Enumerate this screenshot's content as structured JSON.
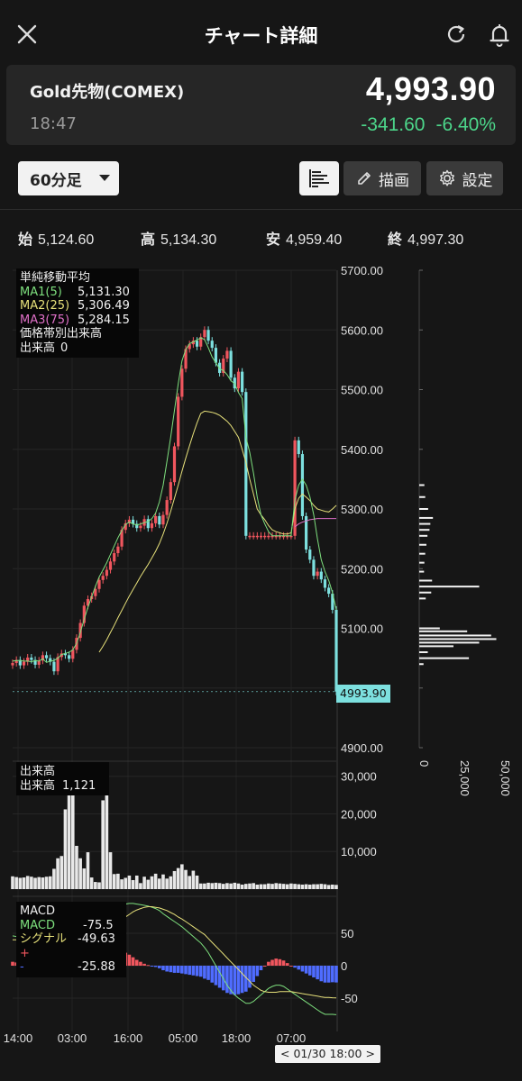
{
  "header": {
    "title": "チャート詳細"
  },
  "quote": {
    "instrument": "Gold先物(COMEX)",
    "time": "18:47",
    "price": "4,993.90",
    "change": "-341.60",
    "change_pct": "-6.40%",
    "down_color": "#4cd68a"
  },
  "controls": {
    "interval": "60分足",
    "draw_label": "描画",
    "settings_label": "設定"
  },
  "ohlc": {
    "open_label": "始",
    "open": "5,124.60",
    "high_label": "高",
    "high": "5,134.30",
    "low_label": "安",
    "low": "4,959.40",
    "close_label": "終",
    "close": "4,997.30"
  },
  "legend_main": {
    "title": "単純移動平均",
    "ma1_label": "MA1(5)",
    "ma1_value": "5,131.30",
    "ma2_label": "MA2(25)",
    "ma2_value": "5,306.49",
    "ma3_label": "MA3(75)",
    "ma3_value": "5,284.15",
    "profile_title": "価格帯別出来高",
    "profile_label": "出来高",
    "profile_value": "0",
    "ma1_color": "#7ee07e",
    "ma2_color": "#e6e07a",
    "ma3_color": "#e070c8"
  },
  "legend_volume": {
    "title": "出来高",
    "label": "出来高",
    "value": "1,121"
  },
  "legend_macd": {
    "title": "MACD",
    "macd_label": "MACD",
    "macd_value": "-75.5",
    "signal_label": "シグナル",
    "signal_value": "-49.63",
    "plus_label": "+",
    "minus_label": "-",
    "hist_value": "-25.88"
  },
  "badges": {
    "last_price": "4993.90",
    "cursor_time": "< 01/30 18:00 >"
  },
  "chart_data": {
    "type": "candlestick",
    "price_axis": {
      "ticks": [
        "5700.00",
        "5600.00",
        "5500.00",
        "5400.00",
        "5300.00",
        "5200.00",
        "5100.00",
        "4900.00"
      ],
      "ylim": [
        4900,
        5700
      ]
    },
    "volume_axis": {
      "ticks": [
        "30,000",
        "20,000",
        "10,000"
      ]
    },
    "macd_axis": {
      "ticks": [
        "50",
        "0",
        "-50"
      ]
    },
    "profile_axis": {
      "ticks": [
        "0",
        "25,000",
        "50,000"
      ]
    },
    "time_axis": {
      "ticks": [
        "14:00",
        "03:00",
        "16:00",
        "05:00",
        "18:00",
        "07:00"
      ]
    },
    "close": [
      5042,
      5047,
      5038,
      5044,
      5051,
      5047,
      5039,
      5046,
      5055,
      5050,
      5044,
      5028,
      5052,
      5058,
      5055,
      5049,
      5064,
      5084,
      5109,
      5138,
      5149,
      5154,
      5166,
      5181,
      5188,
      5198,
      5212,
      5226,
      5237,
      5265,
      5276,
      5282,
      5275,
      5268,
      5272,
      5283,
      5268,
      5276,
      5288,
      5274,
      5290,
      5315,
      5345,
      5405,
      5488,
      5535,
      5568,
      5576,
      5582,
      5572,
      5588,
      5600,
      5582,
      5570,
      5545,
      5528,
      5552,
      5565,
      5520,
      5502,
      5530,
      5496,
      5255,
      5255,
      5255,
      5255,
      5255,
      5255,
      5255,
      5255,
      5255,
      5255,
      5255,
      5255,
      5255,
      5415,
      5392,
      5288,
      5232,
      5215,
      5188,
      5195,
      5182,
      5168,
      5158,
      5131,
      4994
    ],
    "ma1": [
      5045,
      5046,
      5046,
      5045,
      5045,
      5044,
      5046,
      5045,
      5049,
      5043,
      5045,
      5046,
      5050,
      5056,
      5058,
      5060,
      5064,
      5075,
      5093,
      5115,
      5135,
      5153,
      5170,
      5186,
      5198,
      5210,
      5224,
      5238,
      5252,
      5264,
      5274,
      5278,
      5275,
      5273,
      5275,
      5277,
      5279,
      5284,
      5293,
      5312,
      5340,
      5380,
      5420,
      5465,
      5510,
      5548,
      5567,
      5577,
      5580,
      5583,
      5587,
      5584,
      5570,
      5555,
      5545,
      5535,
      5532,
      5525,
      5515,
      5510,
      5495,
      5485,
      5420,
      5395,
      5360,
      5320,
      5290,
      5275,
      5262,
      5255,
      5255,
      5255,
      5255,
      5255,
      5255,
      5315,
      5340,
      5350,
      5340,
      5320,
      5290,
      5250,
      5215,
      5195,
      5180,
      5160,
      5131
    ],
    "ma2": [
      null,
      null,
      null,
      null,
      null,
      null,
      null,
      null,
      null,
      null,
      null,
      null,
      null,
      null,
      null,
      null,
      null,
      null,
      null,
      null,
      null,
      null,
      null,
      5060,
      5070,
      5081,
      5093,
      5105,
      5118,
      5130,
      5142,
      5154,
      5165,
      5176,
      5187,
      5197,
      5207,
      5218,
      5229,
      5242,
      5258,
      5276,
      5296,
      5318,
      5340,
      5363,
      5385,
      5406,
      5426,
      5444,
      5460,
      5464,
      5463,
      5462,
      5460,
      5457,
      5452,
      5447,
      5440,
      5430,
      5420,
      5400,
      5378,
      5350,
      5325,
      5300,
      5290,
      5282,
      5272,
      5265,
      5262,
      5260,
      5258,
      5258,
      5260,
      5300,
      5318,
      5325,
      5320,
      5314,
      5306,
      5300,
      5298,
      5296,
      5295,
      5300,
      5306
    ],
    "ma3": [
      null,
      null,
      null,
      null,
      null,
      null,
      null,
      null,
      null,
      null,
      null,
      null,
      null,
      null,
      null,
      null,
      null,
      null,
      null,
      null,
      null,
      null,
      null,
      null,
      null,
      null,
      null,
      null,
      null,
      null,
      null,
      null,
      null,
      null,
      null,
      null,
      null,
      null,
      null,
      null,
      null,
      null,
      null,
      null,
      null,
      null,
      null,
      null,
      null,
      null,
      null,
      null,
      null,
      null,
      null,
      null,
      null,
      null,
      null,
      null,
      null,
      null,
      null,
      null,
      null,
      null,
      null,
      null,
      null,
      null,
      null,
      null,
      null,
      null,
      null,
      5270,
      5275,
      5278,
      5280,
      5282,
      5283,
      5284,
      5284,
      5284,
      5284,
      5284,
      5284
    ],
    "volume": [
      3400,
      3200,
      3000,
      3100,
      3500,
      3300,
      3000,
      3200,
      3100,
      3300,
      3400,
      5400,
      8200,
      8800,
      21200,
      28500,
      26800,
      11500,
      8200,
      5500,
      9800,
      3100,
      1900,
      1800,
      23600,
      28300,
      9800,
      4000,
      4100,
      2600,
      3000,
      3600,
      2400,
      3600,
      1600,
      3300,
      2500,
      3400,
      4100,
      2800,
      3900,
      2800,
      3400,
      4800,
      5600,
      6600,
      5100,
      3500,
      4900,
      3600,
      1500,
      1500,
      1700,
      1600,
      1700,
      1600,
      1400,
      1600,
      1500,
      1700,
      1500,
      1200,
      1400,
      1500,
      1600,
      1200,
      1300,
      1300,
      1500,
      1400,
      1600,
      1500,
      1400,
      1300,
      1500,
      1400,
      1300,
      1200,
      1300,
      1200,
      1300,
      1300,
      1400,
      1300,
      1100,
      1200,
      1121
    ],
    "macd": [
      46,
      45,
      44,
      43,
      42,
      42,
      40,
      38,
      36,
      34,
      33,
      32,
      30,
      31,
      32,
      33,
      34,
      36,
      39,
      43,
      46,
      50,
      54,
      58,
      62,
      68,
      76,
      82,
      88,
      92,
      95,
      96,
      96,
      95,
      94,
      93,
      92,
      90,
      88,
      85,
      80,
      76,
      72,
      68,
      64,
      60,
      55,
      50,
      45,
      40,
      35,
      28,
      20,
      10,
      0,
      -10,
      -20,
      -30,
      -38,
      -45,
      -50,
      -54,
      -58,
      -58,
      -55,
      -50,
      -45,
      -40,
      -35,
      -32,
      -30,
      -30,
      -32,
      -36,
      -40,
      -44,
      -48,
      -52,
      -56,
      -60,
      -64,
      -68,
      -72,
      -75,
      -75,
      -75,
      -75.5
    ],
    "signal": [
      40,
      40,
      40,
      39,
      39,
      38,
      38,
      37,
      36,
      35,
      34,
      33,
      32,
      32,
      32,
      32,
      33,
      33,
      34,
      35,
      37,
      39,
      41,
      44,
      47,
      51,
      55,
      60,
      65,
      70,
      75,
      79,
      83,
      86,
      88,
      90,
      91,
      91,
      90,
      89,
      87,
      85,
      82,
      79,
      75,
      72,
      68,
      64,
      60,
      56,
      52,
      48,
      42,
      36,
      30,
      24,
      18,
      12,
      6,
      0,
      -6,
      -12,
      -18,
      -24,
      -30,
      -34,
      -38,
      -40,
      -41,
      -41,
      -41,
      -40,
      -40,
      -40,
      -40,
      -41,
      -42,
      -43,
      -44,
      -45,
      -46,
      -47,
      -48,
      -49,
      -49,
      -49.5,
      -49.63
    ],
    "profile_volume": [
      {
        "price": 5340,
        "vol": 3000
      },
      {
        "price": 5320,
        "vol": 3500
      },
      {
        "price": 5300,
        "vol": 5200
      },
      {
        "price": 5285,
        "vol": 8000
      },
      {
        "price": 5275,
        "vol": 6500
      },
      {
        "price": 5265,
        "vol": 6000
      },
      {
        "price": 5255,
        "vol": 4800
      },
      {
        "price": 5240,
        "vol": 4200
      },
      {
        "price": 5225,
        "vol": 3500
      },
      {
        "price": 5210,
        "vol": 3000
      },
      {
        "price": 5195,
        "vol": 2800
      },
      {
        "price": 5180,
        "vol": 7500
      },
      {
        "price": 5170,
        "vol": 35000
      },
      {
        "price": 5160,
        "vol": 7000
      },
      {
        "price": 5150,
        "vol": 3800
      },
      {
        "price": 5100,
        "vol": 12000
      },
      {
        "price": 5095,
        "vol": 28000
      },
      {
        "price": 5088,
        "vol": 42000
      },
      {
        "price": 5082,
        "vol": 45000
      },
      {
        "price": 5076,
        "vol": 35000
      },
      {
        "price": 5070,
        "vol": 20000
      },
      {
        "price": 5060,
        "vol": 5000
      },
      {
        "price": 5050,
        "vol": 29000
      },
      {
        "price": 5040,
        "vol": 2500
      }
    ]
  }
}
